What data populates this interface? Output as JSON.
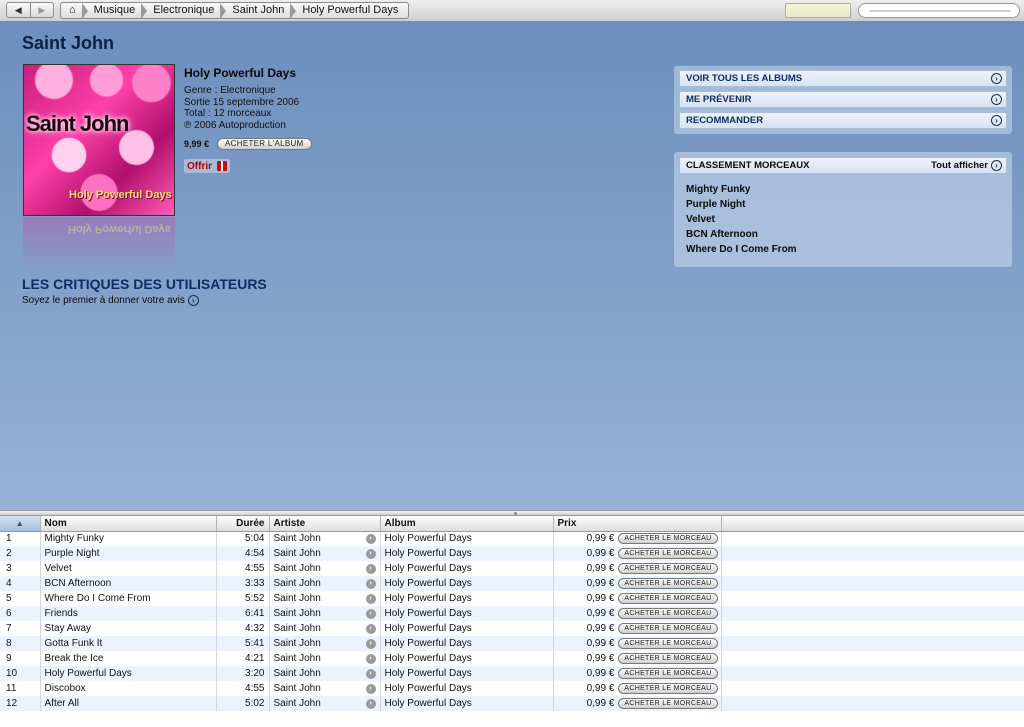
{
  "nav": {
    "back_icon": "◀",
    "forward_icon": "▶",
    "home_icon": "⌂",
    "breadcrumb": [
      "Musique",
      "Electronique",
      "Saint John",
      "Holy Powerful Days"
    ]
  },
  "artist": {
    "name": "Saint John"
  },
  "album": {
    "title": "Holy Powerful Days",
    "genre": "Genre : Electronique",
    "release": "Sortie 15 septembre 2006",
    "total": "Total : 12 morceaux",
    "copyright": "℗ 2006 Autoproduction",
    "price": "9,99 €",
    "buy_label": "Acheter l'album",
    "offer_label": "Offrir",
    "cover_artist_text": "Saint John",
    "cover_album_text": "Holy Powerful Days"
  },
  "reviews": {
    "heading": "LES CRITIQUES DES UTILISATEURS",
    "prompt": "Soyez le premier à donner votre avis"
  },
  "links": [
    "VOIR TOUS LES ALBUMS",
    "ME PRÉVENIR",
    "RECOMMANDER"
  ],
  "top_tracks": {
    "heading": "CLASSEMENT MORCEAUX",
    "show_all": "Tout afficher",
    "items": [
      "Mighty Funky",
      "Purple Night",
      "Velvet",
      "BCN Afternoon",
      "Where Do I Come From"
    ]
  },
  "table": {
    "columns": {
      "num": "",
      "name": "Nom",
      "duration": "Durée",
      "artist": "Artiste",
      "album": "Album",
      "price": "Prix"
    },
    "sort_icon": "▲",
    "buy_track_label": "Acheter le morceau",
    "rows": [
      {
        "num": "1",
        "name": "Mighty Funky",
        "duration": "5:04",
        "artist": "Saint John",
        "album": "Holy Powerful Days",
        "price": "0,99 €"
      },
      {
        "num": "2",
        "name": "Purple Night",
        "duration": "4:54",
        "artist": "Saint John",
        "album": "Holy Powerful Days",
        "price": "0,99 €"
      },
      {
        "num": "3",
        "name": "Velvet",
        "duration": "4:55",
        "artist": "Saint John",
        "album": "Holy Powerful Days",
        "price": "0,99 €"
      },
      {
        "num": "4",
        "name": "BCN Afternoon",
        "duration": "3:33",
        "artist": "Saint John",
        "album": "Holy Powerful Days",
        "price": "0,99 €"
      },
      {
        "num": "5",
        "name": "Where Do I Come From",
        "duration": "5:52",
        "artist": "Saint John",
        "album": "Holy Powerful Days",
        "price": "0,99 €"
      },
      {
        "num": "6",
        "name": "Friends",
        "duration": "6:41",
        "artist": "Saint John",
        "album": "Holy Powerful Days",
        "price": "0,99 €"
      },
      {
        "num": "7",
        "name": "Stay Away",
        "duration": "4:32",
        "artist": "Saint John",
        "album": "Holy Powerful Days",
        "price": "0,99 €"
      },
      {
        "num": "8",
        "name": "Gotta Funk It",
        "duration": "5:41",
        "artist": "Saint John",
        "album": "Holy Powerful Days",
        "price": "0,99 €"
      },
      {
        "num": "9",
        "name": "Break the Ice",
        "duration": "4:21",
        "artist": "Saint John",
        "album": "Holy Powerful Days",
        "price": "0,99 €"
      },
      {
        "num": "10",
        "name": "Holy Powerful Days",
        "duration": "3:20",
        "artist": "Saint John",
        "album": "Holy Powerful Days",
        "price": "0,99 €"
      },
      {
        "num": "11",
        "name": "Discobox",
        "duration": "4:55",
        "artist": "Saint John",
        "album": "Holy Powerful Days",
        "price": "0,99 €"
      },
      {
        "num": "12",
        "name": "After All",
        "duration": "5:02",
        "artist": "Saint John",
        "album": "Holy Powerful Days",
        "price": "0,99 €"
      }
    ]
  }
}
